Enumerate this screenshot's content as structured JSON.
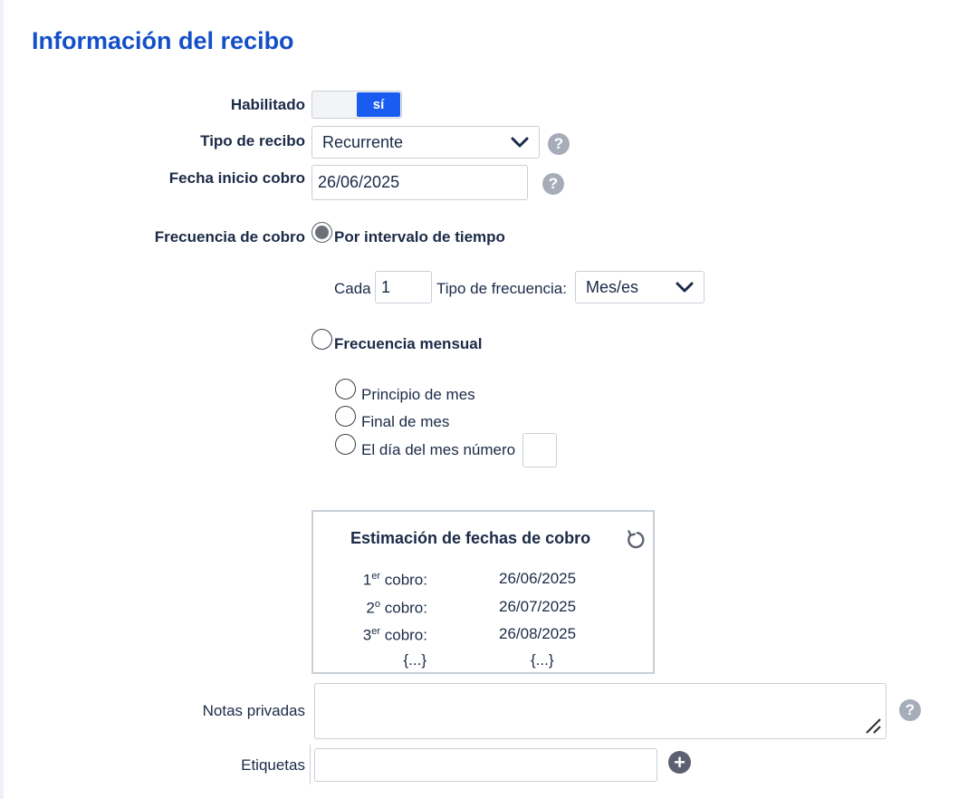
{
  "section_title": "Información del recibo",
  "enabled": {
    "label": "Habilitado",
    "on_label": "sí"
  },
  "receipt_type": {
    "label": "Tipo de recibo",
    "value": "Recurrente"
  },
  "start_date": {
    "label": "Fecha inicio cobro",
    "value": "26/06/2025"
  },
  "help_glyph": "?",
  "frequency": {
    "label": "Frecuencia de cobro",
    "interval_option": "Por intervalo de tiempo",
    "every_label": "Cada",
    "every_value": "1",
    "freq_type_label": "Tipo de frecuencia:",
    "freq_type_value": "Mes/es",
    "monthly_option": "Frecuencia mensual",
    "monthly_suboptions": [
      "Principio de mes",
      "Final de mes",
      "El día del mes número"
    ]
  },
  "estimate": {
    "title": "Estimación de fechas de cobro",
    "rows": [
      {
        "num": "1",
        "sup": "er",
        "label": " cobro:",
        "date": "26/06/2025"
      },
      {
        "num": "2",
        "sup": "o",
        "label": " cobro:",
        "date": "26/07/2025"
      },
      {
        "num": "3",
        "sup": "er",
        "label": " cobro:",
        "date": "26/08/2025"
      }
    ],
    "ellipsis": "{...}"
  },
  "private_notes": {
    "label": "Notas privadas",
    "value": ""
  },
  "tags": {
    "label": "Etiquetas",
    "value": "",
    "add_glyph": "+"
  },
  "colors": {
    "accent": "#1a5cf2",
    "title": "#1350c8",
    "text": "#1b2a47",
    "help": "#a7adb8"
  },
  "icons": {
    "select": "chevron-down-icon",
    "help": "question-circle-icon",
    "refresh": "refresh-icon",
    "add": "plus-circle-icon",
    "resize": "resize-handle-icon"
  }
}
